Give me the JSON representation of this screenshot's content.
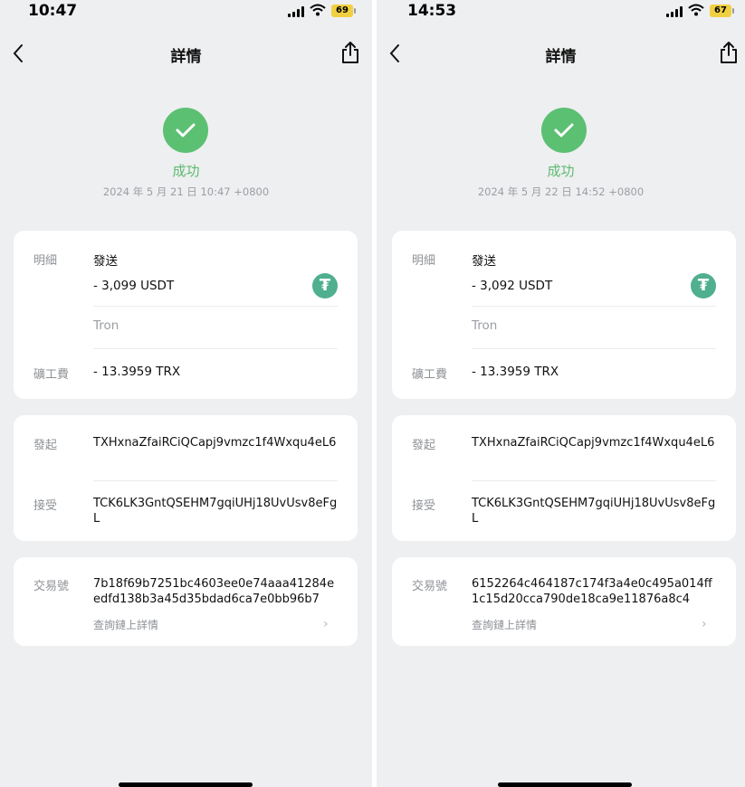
{
  "screens": [
    {
      "status_bar": {
        "time": "10:47",
        "battery": "69"
      },
      "nav": {
        "title": "詳情"
      },
      "result": {
        "status": "成功",
        "datetime": "2024 年 5 月 21 日 10:47 +0800"
      },
      "details": {
        "label": "明細",
        "action": "發送",
        "amount": "- 3,099 USDT",
        "token_icon": "₮",
        "network": "Tron",
        "fee_label": "礦工費",
        "fee": "- 13.3959 TRX"
      },
      "addresses": {
        "from_label": "發起",
        "from": "TXHxnaZfaiRCiQCapj9vmzc1f4Wxqu4eL6",
        "to_label": "接受",
        "to": "TCK6LK3GntQSEHM7gqiUHj18UvUsv8eFgL"
      },
      "tx": {
        "label": "交易號",
        "hash": "7b18f69b7251bc4603ee0e74aaa41284eedfd138b3a45d35bdad6ca7e0bb96b7",
        "link": "查詢鏈上詳情"
      }
    },
    {
      "status_bar": {
        "time": "14:53",
        "battery": "67"
      },
      "nav": {
        "title": "詳情"
      },
      "result": {
        "status": "成功",
        "datetime": "2024 年 5 月 22 日 14:52 +0800"
      },
      "details": {
        "label": "明細",
        "action": "發送",
        "amount": "- 3,092 USDT",
        "token_icon": "₮",
        "network": "Tron",
        "fee_label": "礦工費",
        "fee": "- 13.3959 TRX"
      },
      "addresses": {
        "from_label": "發起",
        "from": "TXHxnaZfaiRCiQCapj9vmzc1f4Wxqu4eL6",
        "to_label": "接受",
        "to": "TCK6LK3GntQSEHM7gqiUHj18UvUsv8eFgL"
      },
      "tx": {
        "label": "交易號",
        "hash": "6152264c464187c174f3a4e0c495a014ff1c15d20cca790de18ca9e11876a8c4",
        "link": "查詢鏈上詳情"
      }
    }
  ],
  "colors": {
    "success": "#5cc073",
    "tether": "#4faf8e",
    "battery": "#f0d040"
  },
  "icons": {
    "back": "chevron-left-icon",
    "share": "share-icon",
    "check": "checkmark-icon",
    "token": "tether-icon",
    "more": "chevron-right-icon"
  }
}
